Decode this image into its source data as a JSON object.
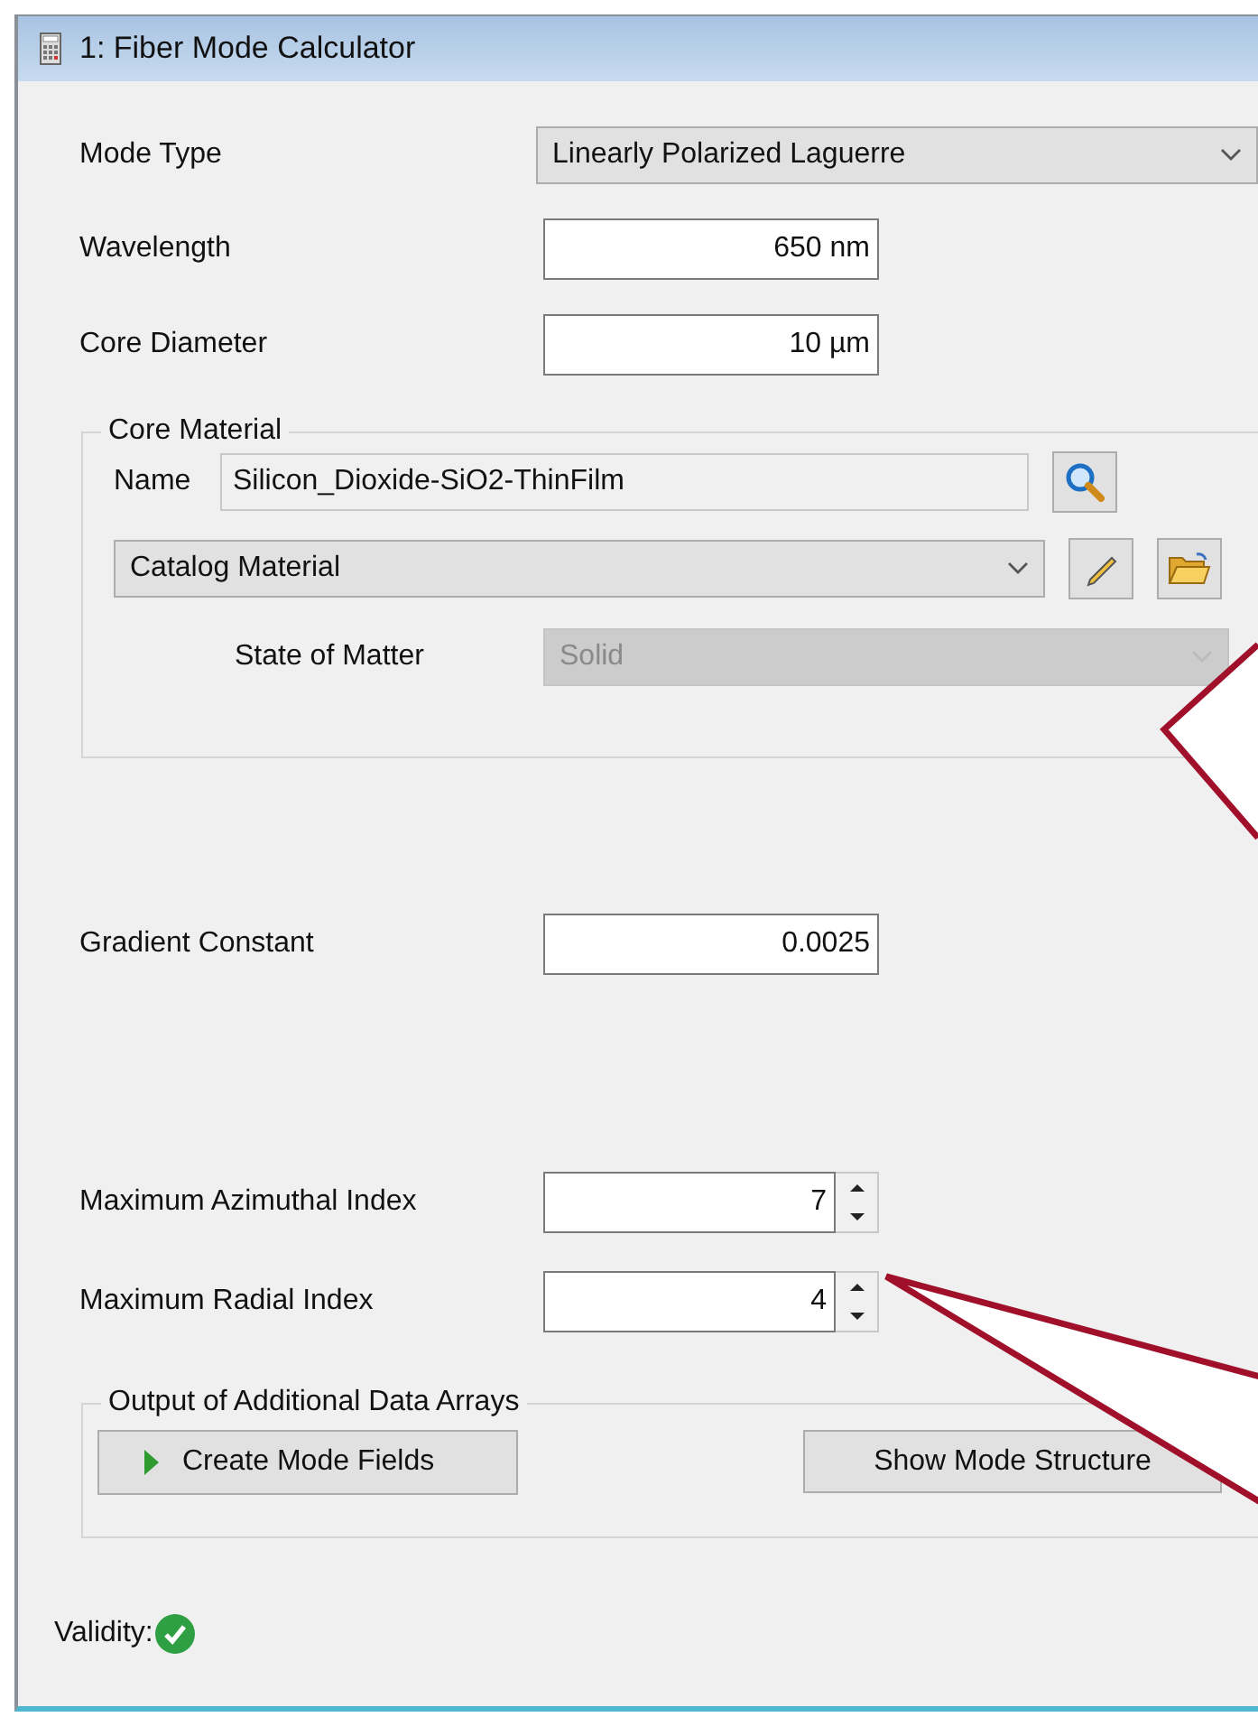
{
  "window": {
    "title": "1: Fiber Mode Calculator"
  },
  "mode_type": {
    "label": "Mode Type",
    "value": "Linearly Polarized Laguerre"
  },
  "wavelength": {
    "label": "Wavelength",
    "value": "650 nm"
  },
  "core_diameter": {
    "label": "Core Diameter",
    "value": "10 µm"
  },
  "core_material": {
    "title": "Core Material",
    "name_label": "Name",
    "name_value": "Silicon_Dioxide-SiO2-ThinFilm",
    "catalog": "Catalog Material",
    "state_of_matter": {
      "label": "State of Matter",
      "value": "Solid",
      "disabled": true
    }
  },
  "gradient_constant": {
    "label": "Gradient Constant",
    "value": "0.0025"
  },
  "max_azimuthal": {
    "label": "Maximum Azimuthal Index",
    "value": "7"
  },
  "max_radial": {
    "label": "Maximum Radial Index",
    "value": "4"
  },
  "output_arrays": {
    "title": "Output of Additional Data Arrays",
    "buttons": [
      {
        "label": "Create Mode Fields",
        "kind": "run"
      },
      {
        "label": "Show Mode Structure",
        "kind": "plain"
      }
    ]
  },
  "validity": {
    "label": "Validity:",
    "valid": true
  }
}
